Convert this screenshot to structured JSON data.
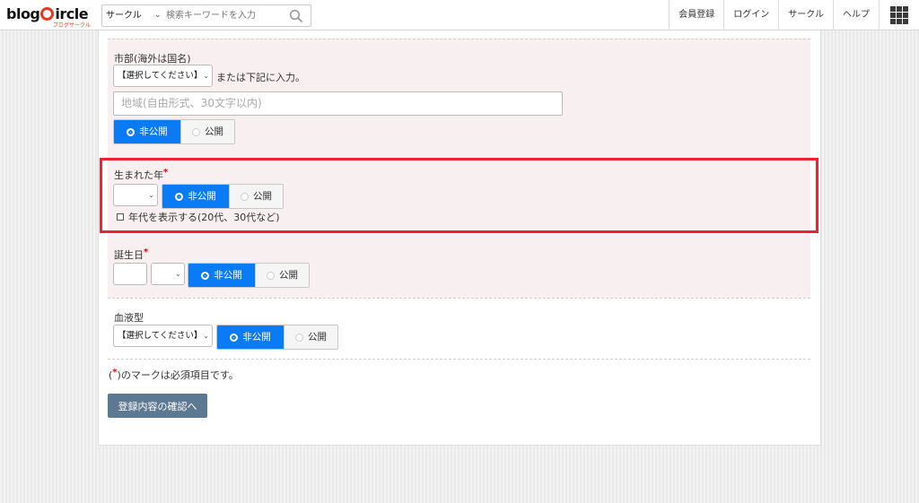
{
  "header": {
    "logo_text_a": "blog",
    "logo_text_b": "ircle",
    "logo_sub": "ブログサークル",
    "search": {
      "category": "サークル",
      "placeholder": "検索キーワードを入力"
    },
    "nav": [
      "会員登録",
      "ログイン",
      "サークル",
      "ヘルプ"
    ]
  },
  "form": {
    "city": {
      "label": "市部(海外は国名)",
      "select_value": "【選択してください】",
      "or_text": "または下記に入力。",
      "region_placeholder": "地域(自由形式、30文字以内)"
    },
    "birth_year": {
      "label": "生まれた年",
      "required_mark": "*",
      "show_age_label": "年代を表示する(20代、30代など)"
    },
    "birthday": {
      "label": "誕生日",
      "required_mark": "*"
    },
    "blood_type": {
      "label": "血液型",
      "select_value": "【選択してください】"
    },
    "privacy": {
      "private": "非公開",
      "public": "公開"
    },
    "required_note_open": "(",
    "required_note_mark": "*",
    "required_note_rest": ")のマークは必須項目です。",
    "confirm_button": "登録内容の確認へ"
  },
  "colors": {
    "accent": "#0a7bf5",
    "required": "#e60012",
    "highlight": "#f0222f",
    "button": "#5d7891",
    "section_bg": "#f8f0f0"
  }
}
